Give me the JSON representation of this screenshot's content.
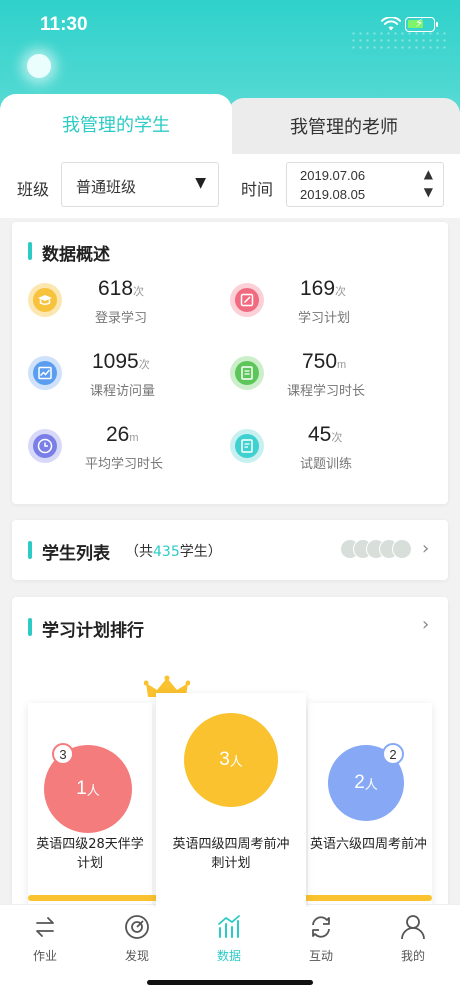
{
  "status_bar": {
    "time": "11:30"
  },
  "tabs": [
    {
      "label": "我管理的学生",
      "active": true
    },
    {
      "label": "我管理的老师",
      "active": false
    }
  ],
  "filters": {
    "class_label": "班级",
    "class_value": "普通班级",
    "time_label": "时间",
    "date_start": "2019.07.06",
    "date_end": "2019.08.05"
  },
  "overview": {
    "title": "数据概述",
    "stats": [
      {
        "value": "618",
        "unit": "次",
        "label": "登录学习",
        "icon": "graduation-cap-icon",
        "color": "#f7c23c"
      },
      {
        "value": "169",
        "unit": "次",
        "label": "学习计划",
        "icon": "edit-icon",
        "color": "#f06b80"
      },
      {
        "value": "1095",
        "unit": "次",
        "label": "课程访问量",
        "icon": "chart-icon",
        "color": "#5b9ef0"
      },
      {
        "value": "750",
        "unit": "m",
        "label": "课程学习时长",
        "icon": "book-icon",
        "color": "#5dc65a"
      },
      {
        "value": "26",
        "unit": "m",
        "label": "平均学习时长",
        "icon": "clock-icon",
        "color": "#7a7fe8"
      },
      {
        "value": "45",
        "unit": "次",
        "label": "试题训练",
        "icon": "document-icon",
        "color": "#3fd0d0"
      }
    ]
  },
  "student_list": {
    "title": "学生列表",
    "count_prefix": "（共",
    "count": "435",
    "count_suffix": "学生）"
  },
  "ranking": {
    "title": "学习计划排行",
    "items": [
      {
        "rank": "3",
        "count": "1",
        "unit": "人",
        "plan": "英语四级28天伴学计划",
        "color": "#f47c7c"
      },
      {
        "rank": "",
        "count": "3",
        "unit": "人",
        "plan": "英语四级四周考前冲刺计划",
        "color": "#f9c22e"
      },
      {
        "rank": "2",
        "count": "2",
        "unit": "人",
        "plan": "英语六级四周考前冲...",
        "color": "#86a8f5"
      }
    ]
  },
  "bottom_nav": [
    {
      "label": "作业",
      "icon": "swap-arrows-icon",
      "active": false
    },
    {
      "label": "发现",
      "icon": "compass-icon",
      "active": false
    },
    {
      "label": "数据",
      "icon": "bar-chart-icon",
      "active": true
    },
    {
      "label": "互动",
      "icon": "refresh-icon",
      "active": false
    },
    {
      "label": "我的",
      "icon": "user-icon",
      "active": false
    }
  ],
  "colors": {
    "accent": "#2ccbc6"
  }
}
